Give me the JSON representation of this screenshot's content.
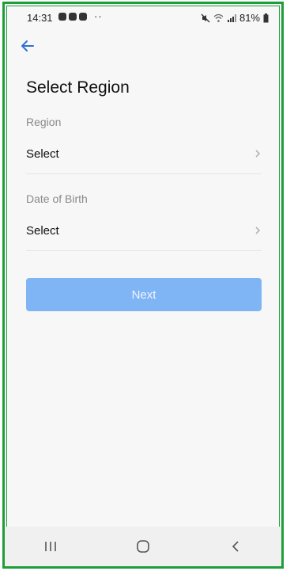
{
  "status_bar": {
    "time": "14:31",
    "more": "··",
    "battery": "81%"
  },
  "screen": {
    "title": "Select Region",
    "region": {
      "label": "Region",
      "value": "Select"
    },
    "dob": {
      "label": "Date of Birth",
      "value": "Select"
    },
    "next_label": "Next"
  },
  "icons": {
    "back": "arrow-left-icon",
    "chevron": "chevron-right-icon",
    "recents": "recent-apps-icon",
    "home": "home-icon",
    "nav_back": "navigation-back-icon"
  },
  "colors": {
    "accent": "#2f6fd6",
    "button_disabled": "#7fb5f5",
    "frame_border": "#1e9e3a"
  }
}
